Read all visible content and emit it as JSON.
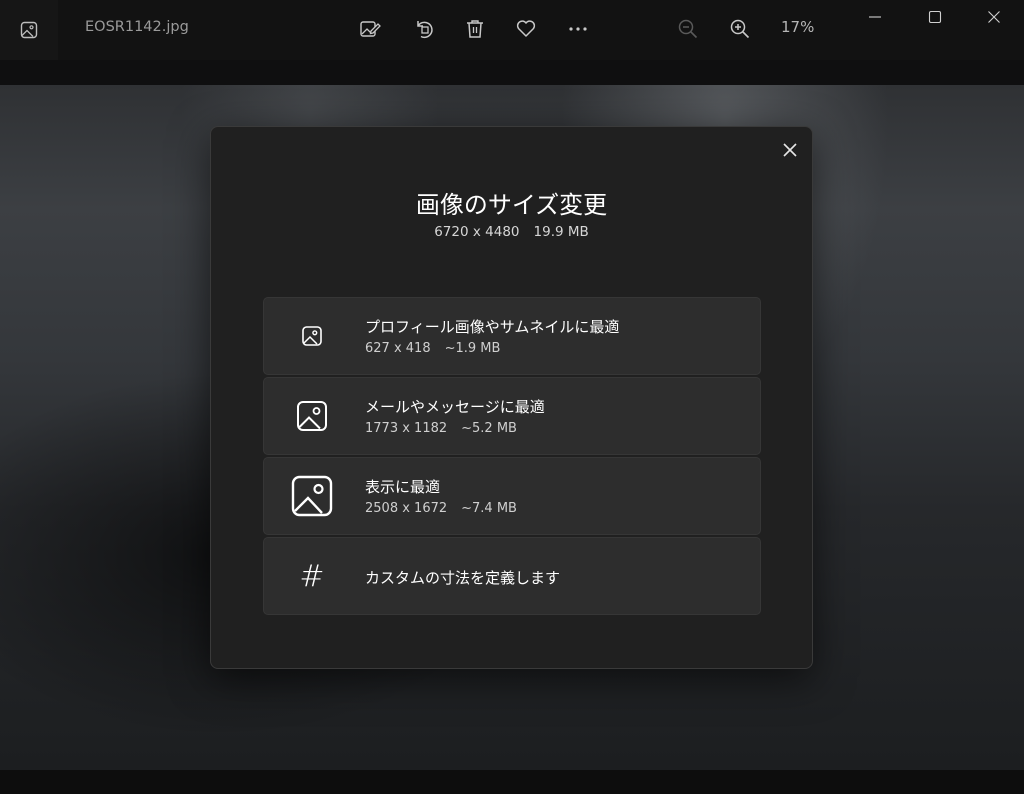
{
  "titlebar": {
    "app_icon": "photo-app-icon",
    "filename": "EOSR1142.jpg",
    "tools": [
      "edit-image-icon",
      "rotate-icon",
      "delete-icon",
      "favorite-icon",
      "more-icon",
      "zoom-out-icon",
      "zoom-in-icon"
    ],
    "zoom_level": "17%",
    "window_controls": [
      "minimize-icon",
      "maximize-icon",
      "close-window-icon"
    ]
  },
  "dialog": {
    "title": "画像のサイズ変更",
    "dimensions": "6720 x 4480",
    "file_size": "19.9 MB",
    "options": [
      {
        "label": "プロフィール画像やサムネイルに最適",
        "dimensions": "627 x 418",
        "size": "~1.9 MB",
        "icon": "image-small-icon"
      },
      {
        "label": "メールやメッセージに最適",
        "dimensions": "1773 x 1182",
        "size": "~5.2 MB",
        "icon": "image-medium-icon"
      },
      {
        "label": "表示に最適",
        "dimensions": "2508 x 1672",
        "size": "~7.4 MB",
        "icon": "image-large-icon"
      },
      {
        "label": "カスタムの寸法を定義します",
        "icon": "hash-icon",
        "glyph": "#"
      }
    ]
  }
}
